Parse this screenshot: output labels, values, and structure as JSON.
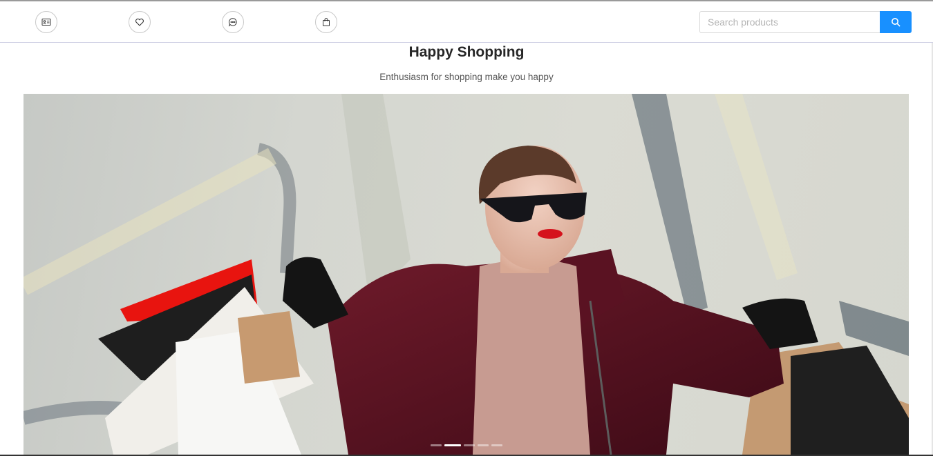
{
  "navbar": {
    "icons": [
      "id-card-icon",
      "heart-icon",
      "message-icon",
      "shopping-bag-icon"
    ],
    "search": {
      "placeholder": "Search products",
      "value": ""
    }
  },
  "hero": {
    "title": "Happy Shopping",
    "subtitle": "Enthusiasm for shopping make you happy"
  },
  "carousel": {
    "slide_count": 5,
    "active_index": 1
  },
  "colors": {
    "accent": "#1890ff",
    "navbar_border": "#cfd0e4"
  }
}
